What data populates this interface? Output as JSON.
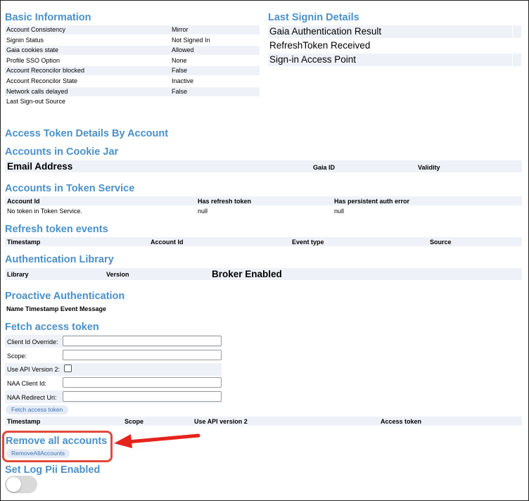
{
  "basic": {
    "title": "Basic Information",
    "rows": [
      {
        "label": "Account Consistency",
        "value": "Mirror"
      },
      {
        "label": "Signin Status",
        "value": "Not Signed In"
      },
      {
        "label": "Gaia cookies state",
        "value": "Allowed"
      },
      {
        "label": "Profile SSO Option",
        "value": "None"
      },
      {
        "label": "Account Reconcilor blocked",
        "value": "False"
      },
      {
        "label": "Account Reconcilor State",
        "value": "Inactive"
      },
      {
        "label": "Network calls delayed",
        "value": "False"
      },
      {
        "label": "Last Sign-out Source",
        "value": ""
      }
    ]
  },
  "last_signin": {
    "title": "Last Signin Details",
    "rows": [
      "Gaia Authentication Result",
      "RefreshToken Received",
      "Sign-in Access Point"
    ]
  },
  "access_token_details": {
    "title": "Access Token Details By Account"
  },
  "cookie_jar": {
    "title": "Accounts in Cookie Jar",
    "col_email": "Email Address",
    "col_gaia": "Gaia ID",
    "col_validity": "Validity"
  },
  "token_service": {
    "title": "Accounts in Token Service",
    "headers": [
      "Account Id",
      "Has refresh token",
      "Has persistent auth error"
    ],
    "row": [
      "No token in Token Service.",
      "null",
      "null"
    ]
  },
  "refresh_events": {
    "title": "Refresh token events",
    "headers": [
      "Timestamp",
      "Account Id",
      "Event type",
      "Source"
    ]
  },
  "auth_library": {
    "title": "Authentication Library",
    "headers": [
      "Library",
      "Version",
      "Broker Enabled"
    ]
  },
  "proactive": {
    "title": "Proactive Authentication",
    "headers": [
      "Name",
      "Timestamp",
      "Event",
      "Message"
    ]
  },
  "fetch": {
    "title": "Fetch access token",
    "client_id_label": "Client Id Override:",
    "scope_label": "Scope:",
    "api_v2_label": "Use API Version 2:",
    "naa_client_label": "NAA Client Id:",
    "naa_redirect_label": "NAA Redirect Uri:",
    "client_id_value": "",
    "scope_value": "",
    "naa_client_value": "",
    "naa_redirect_value": "",
    "button": "Fetch access token",
    "headers": [
      "Timestamp",
      "Scope",
      "Use API version 2",
      "Access token"
    ]
  },
  "remove": {
    "title": "Remove all accounts",
    "button": "RemoveAllAccounts"
  },
  "log_pii": {
    "title": "Set Log Pii Enabled",
    "enabled": false
  },
  "colors": {
    "heading": "#4a90c8",
    "shade": "#eef2f8",
    "annotation": "#e24a3b"
  }
}
